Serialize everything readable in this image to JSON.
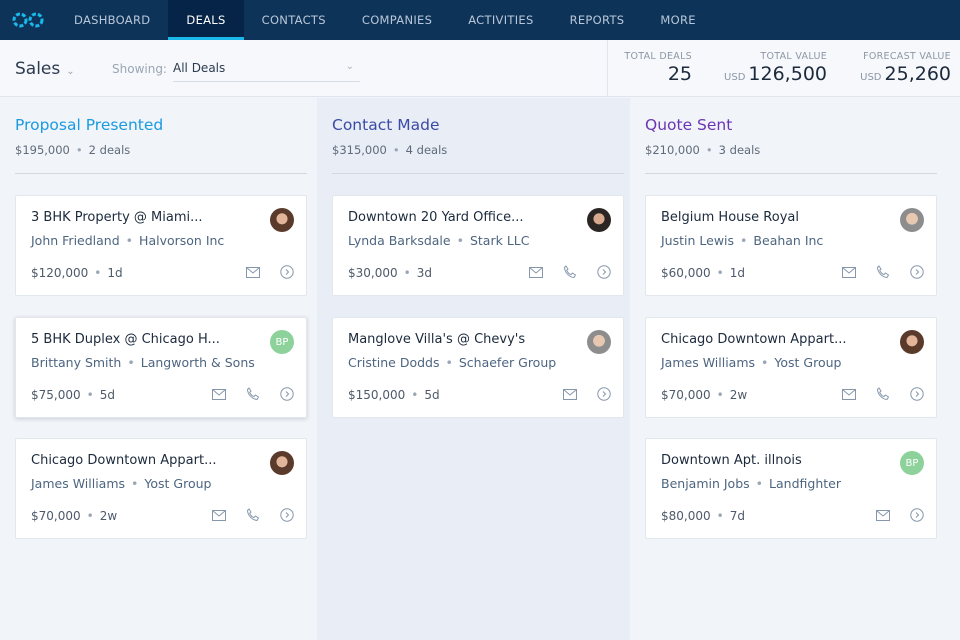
{
  "nav": {
    "tabs": [
      "DASHBOARD",
      "DEALS",
      "CONTACTS",
      "COMPANIES",
      "ACTIVITIES",
      "REPORTS",
      "MORE"
    ],
    "active": 1
  },
  "header": {
    "pipeline": "Sales",
    "showing_label": "Showing:",
    "filter": "All Deals",
    "stats": [
      {
        "label": "TOTAL DEALS",
        "currency": "",
        "value": "25"
      },
      {
        "label": "TOTAL VALUE",
        "currency": "USD",
        "value": "126,500"
      },
      {
        "label": "FORECAST VALUE",
        "currency": "USD",
        "value": "25,260"
      }
    ]
  },
  "colors": {
    "nav": "#0e3359",
    "accent": "#1ab7ea",
    "stage1": "#1a9ae0",
    "stage2": "#3a4ba6",
    "stage3": "#6a35b5"
  },
  "columns": [
    {
      "title": "Proposal Presented",
      "amount": "$195,000",
      "count": "2 deals",
      "cards": [
        {
          "title": "3 BHK Property @ Miami...",
          "contact": "John Friedland",
          "company": "Halvorson Inc",
          "amount": "$120,000",
          "age": "1d",
          "avatar": "photo",
          "phone": false
        },
        {
          "title": "5 BHK Duplex @ Chicago H...",
          "contact": "Brittany Smith",
          "company": "Langworth & Sons",
          "amount": "$75,000",
          "age": "5d",
          "avatar": "BP",
          "phone": true
        },
        {
          "title": "Chicago Downtown Appart...",
          "contact": "James Williams",
          "company": "Yost Group",
          "amount": "$70,000",
          "age": "2w",
          "avatar": "photo",
          "phone": true
        }
      ]
    },
    {
      "title": "Contact Made",
      "amount": "$315,000",
      "count": "4 deals",
      "cards": [
        {
          "title": "Downtown 20 Yard Office...",
          "contact": "Lynda Barksdale",
          "company": "Stark LLC",
          "amount": "$30,000",
          "age": "3d",
          "avatar": "photo3",
          "phone": true
        },
        {
          "title": "Manglove Villa's @ Chevy's",
          "contact": "Cristine Dodds",
          "company": "Schaefer Group",
          "amount": "$150,000",
          "age": "5d",
          "avatar": "photo2",
          "phone": false
        }
      ]
    },
    {
      "title": "Quote Sent",
      "amount": "$210,000",
      "count": "3 deals",
      "cards": [
        {
          "title": "Belgium House Royal",
          "contact": "Justin Lewis",
          "company": "Beahan Inc",
          "amount": "$60,000",
          "age": "1d",
          "avatar": "photo2",
          "phone": true
        },
        {
          "title": "Chicago Downtown Appart...",
          "contact": "James Williams",
          "company": "Yost Group",
          "amount": "$70,000",
          "age": "2w",
          "avatar": "photo",
          "phone": true
        },
        {
          "title": "Downtown Apt. illnois",
          "contact": "Benjamin Jobs",
          "company": "Landfighter",
          "amount": "$80,000",
          "age": "7d",
          "avatar": "BP",
          "phone": false
        }
      ]
    }
  ]
}
